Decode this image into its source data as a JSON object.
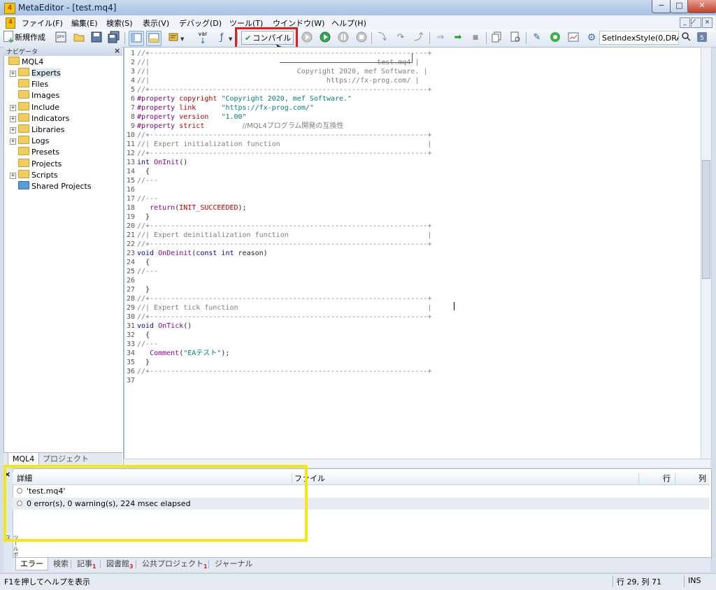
{
  "window": {
    "app_icon": "4",
    "title": "MetaEditor - [test.mq4]",
    "minimize": "−",
    "maximize": "□",
    "close": "✕"
  },
  "menu": [
    "ファイル(F)",
    "編集(E)",
    "検索(S)",
    "表示(V)",
    "デバッグ(D)",
    "ツール(T)",
    "ウインドウ(W)",
    "ヘルプ(H)"
  ],
  "mdi_controls": {
    "minimize": "_",
    "restore": "̸",
    "close": "×"
  },
  "toolbar": {
    "new_file": "新規作成",
    "var_label": "var",
    "compile": "コンパイル",
    "function_box": "SetIndexStyle(0,DRAW",
    "search_icon": "search-icon"
  },
  "navigator": {
    "header": "ナビゲータ",
    "close": "×",
    "root": "MQL4",
    "items": [
      {
        "label": "Experts",
        "expandable": true
      },
      {
        "label": "Files",
        "expandable": false
      },
      {
        "label": "Images",
        "expandable": false
      },
      {
        "label": "Include",
        "expandable": true
      },
      {
        "label": "Indicators",
        "expandable": true
      },
      {
        "label": "Libraries",
        "expandable": true
      },
      {
        "label": "Logs",
        "expandable": true
      },
      {
        "label": "Presets",
        "expandable": false
      },
      {
        "label": "Projects",
        "expandable": false
      },
      {
        "label": "Scripts",
        "expandable": true
      },
      {
        "label": "Shared Projects",
        "expandable": false
      }
    ],
    "tabs": [
      "MQL4",
      "プロジェクト"
    ]
  },
  "editor": {
    "lines": [
      {
        "n": "1",
        "parts": [
          [
            "c-com",
            "//+------------------------------------------------------------------+"
          ]
        ]
      },
      {
        "n": "2",
        "parts": [
          [
            "c-com",
            "//|                                                      test.mq4 |"
          ]
        ]
      },
      {
        "n": "3",
        "parts": [
          [
            "c-com",
            "//|                                   Copyright 2020, mef Software. |"
          ]
        ]
      },
      {
        "n": "4",
        "parts": [
          [
            "c-com",
            "//|                                          https://fx-prog.com/ |"
          ]
        ]
      },
      {
        "n": "5",
        "parts": [
          [
            "c-com",
            "//+------------------------------------------------------------------+"
          ]
        ]
      },
      {
        "n": "6",
        "parts": [
          [
            "c-pre",
            "#property "
          ],
          [
            "c-prop",
            "copyright "
          ],
          [
            "c-str",
            "\"Copyright 2020, mef Software.\""
          ]
        ]
      },
      {
        "n": "7",
        "parts": [
          [
            "c-pre",
            "#property "
          ],
          [
            "c-prop",
            "link      "
          ],
          [
            "c-str",
            "\"https://fx-prog.com/\""
          ]
        ]
      },
      {
        "n": "8",
        "parts": [
          [
            "c-pre",
            "#property "
          ],
          [
            "c-prop",
            "version   "
          ],
          [
            "c-str",
            "\"1.00\""
          ]
        ]
      },
      {
        "n": "9",
        "parts": [
          [
            "c-pre",
            "#property "
          ],
          [
            "c-prop",
            "strict         "
          ],
          [
            "c-jp",
            "//MQL4プログラム開発の互換性"
          ]
        ]
      },
      {
        "n": "10",
        "parts": [
          [
            "c-com",
            "//+------------------------------------------------------------------+"
          ]
        ]
      },
      {
        "n": "11",
        "parts": [
          [
            "c-com",
            "//| Expert initialization function                                   |"
          ]
        ]
      },
      {
        "n": "12",
        "parts": [
          [
            "c-com",
            "//+------------------------------------------------------------------+"
          ]
        ]
      },
      {
        "n": "13",
        "parts": [
          [
            "c-kw",
            "int "
          ],
          [
            "c-fn",
            "OnInit"
          ],
          [
            "",
            "()"
          ]
        ]
      },
      {
        "n": "14",
        "parts": [
          [
            "",
            "  {"
          ]
        ]
      },
      {
        "n": "15",
        "parts": [
          [
            "c-com",
            "//---"
          ]
        ]
      },
      {
        "n": "16",
        "parts": [
          [
            "",
            ""
          ]
        ]
      },
      {
        "n": "17",
        "parts": [
          [
            "c-com",
            "//---"
          ]
        ]
      },
      {
        "n": "18",
        "parts": [
          [
            "",
            "   "
          ],
          [
            "c-fn",
            "return"
          ],
          [
            "",
            "("
          ],
          [
            "c-const",
            "INIT_SUCCEEDED"
          ],
          [
            "",
            ");"
          ]
        ]
      },
      {
        "n": "19",
        "parts": [
          [
            "",
            "  }"
          ]
        ]
      },
      {
        "n": "20",
        "parts": [
          [
            "c-com",
            "//+------------------------------------------------------------------+"
          ]
        ]
      },
      {
        "n": "21",
        "parts": [
          [
            "c-com",
            "//| Expert deinitialization function                                 |"
          ]
        ]
      },
      {
        "n": "22",
        "parts": [
          [
            "c-com",
            "//+------------------------------------------------------------------+"
          ]
        ]
      },
      {
        "n": "23",
        "parts": [
          [
            "c-kw",
            "void "
          ],
          [
            "c-fn",
            "OnDeinit"
          ],
          [
            "",
            "("
          ],
          [
            "c-kw",
            "const int "
          ],
          [
            "",
            "reason)"
          ]
        ]
      },
      {
        "n": "24",
        "parts": [
          [
            "",
            "  {"
          ]
        ]
      },
      {
        "n": "25",
        "parts": [
          [
            "c-com",
            "//---"
          ]
        ]
      },
      {
        "n": "26",
        "parts": [
          [
            "",
            ""
          ]
        ]
      },
      {
        "n": "27",
        "parts": [
          [
            "",
            "  }"
          ]
        ]
      },
      {
        "n": "28",
        "parts": [
          [
            "c-com",
            "//+------------------------------------------------------------------+"
          ]
        ]
      },
      {
        "n": "29",
        "parts": [
          [
            "c-com",
            "//| Expert tick function                                             |"
          ]
        ]
      },
      {
        "n": "30",
        "parts": [
          [
            "c-com",
            "//+------------------------------------------------------------------+"
          ]
        ]
      },
      {
        "n": "31",
        "parts": [
          [
            "c-kw",
            "void "
          ],
          [
            "c-fn",
            "OnTick"
          ],
          [
            "",
            "()"
          ]
        ]
      },
      {
        "n": "32",
        "parts": [
          [
            "",
            "  {"
          ]
        ]
      },
      {
        "n": "33",
        "parts": [
          [
            "c-com",
            "//---"
          ]
        ]
      },
      {
        "n": "34",
        "parts": [
          [
            "",
            "   "
          ],
          [
            "c-fn",
            "Comment"
          ],
          [
            "",
            "("
          ],
          [
            "c-str",
            "\"EAテスト\""
          ],
          [
            "",
            ");"
          ]
        ]
      },
      {
        "n": "35",
        "parts": [
          [
            "",
            "  }"
          ]
        ]
      },
      {
        "n": "36",
        "parts": [
          [
            "c-com",
            "//+------------------------------------------------------------------+"
          ]
        ]
      },
      {
        "n": "37",
        "parts": [
          [
            "",
            ""
          ]
        ]
      }
    ]
  },
  "toolbox": {
    "close": "×",
    "side_label": "ツールボックス",
    "columns": [
      "詳細",
      "ファイル",
      "行",
      "列"
    ],
    "messages": [
      "'test.mq4'",
      "0 error(s), 0 warning(s), 224 msec elapsed"
    ],
    "tabs": [
      {
        "label": "エラー",
        "badge": ""
      },
      {
        "label": "検索",
        "badge": ""
      },
      {
        "label": "記事",
        "badge": "1"
      },
      {
        "label": "図書館",
        "badge": "3"
      },
      {
        "label": "公共プロジェクト",
        "badge": "1"
      },
      {
        "label": "ジャーナル",
        "badge": ""
      }
    ]
  },
  "status": {
    "help": "F1を押してヘルプを表示",
    "position": "行 29, 列 71",
    "mode": "INS"
  },
  "colors": {
    "compile_highlight": "#e0201c",
    "toolbox_highlight": "#f5e614"
  }
}
